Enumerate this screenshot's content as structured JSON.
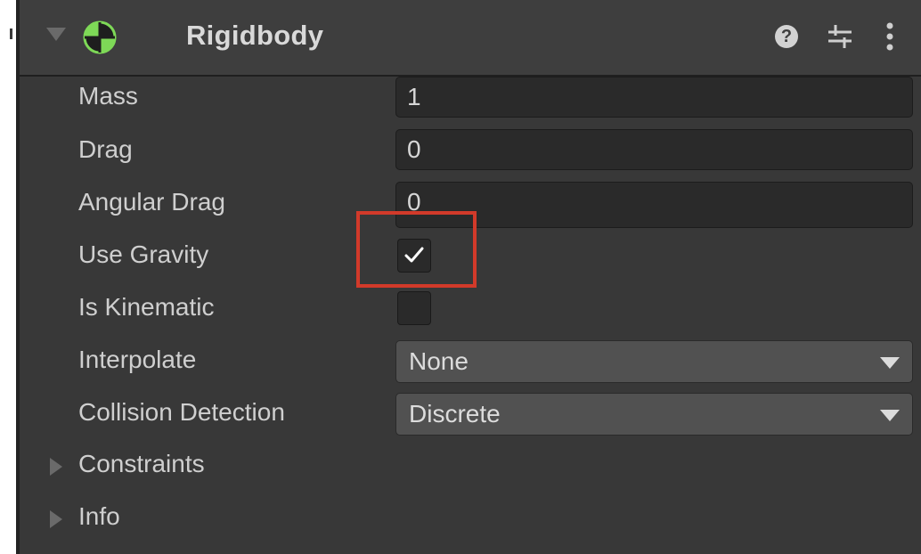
{
  "component": {
    "title": "Rigidbody",
    "icon": "rigidbody-icon",
    "expanded": true,
    "header_icons": [
      "help-icon",
      "presets-icon",
      "more-menu-icon"
    ],
    "help_glyph": "?"
  },
  "properties": {
    "mass": {
      "label": "Mass",
      "value": "1"
    },
    "drag": {
      "label": "Drag",
      "value": "0"
    },
    "angular_drag": {
      "label": "Angular Drag",
      "value": "0"
    },
    "use_gravity": {
      "label": "Use Gravity",
      "checked": true
    },
    "is_kinematic": {
      "label": "Is Kinematic",
      "checked": false
    },
    "interpolate": {
      "label": "Interpolate",
      "selected": "None"
    },
    "collision_detection": {
      "label": "Collision Detection",
      "selected": "Discrete"
    }
  },
  "sections": {
    "constraints": {
      "label": "Constraints",
      "expanded": false
    },
    "info": {
      "label": "Info",
      "expanded": false
    }
  },
  "colors": {
    "panel_bg": "#383838",
    "header_bg": "#3e3e3e",
    "field_bg": "#2a2a2a",
    "dropdown_bg": "#515151",
    "text": "#cfcfcf",
    "icon_green": "#7ed957",
    "highlight": "#d23a2a"
  }
}
